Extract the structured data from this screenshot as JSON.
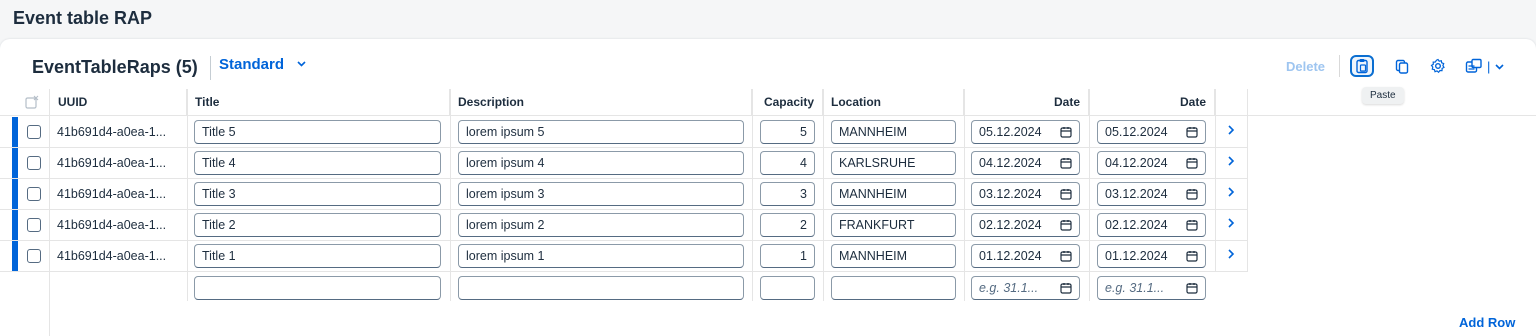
{
  "app": {
    "title": "Event table RAP"
  },
  "table": {
    "title": "EventTableRaps (5)",
    "variant": "Standard",
    "toolbar": {
      "delete": "Delete",
      "tooltip": "Paste"
    },
    "add_row": "Add Row",
    "columns": [
      "UUID",
      "Title",
      "Description",
      "Capacity",
      "Location",
      "Date",
      "Date"
    ],
    "rows": [
      {
        "uuid": "41b691d4-a0ea-1...",
        "title": "Title 5",
        "description": "lorem ipsum 5",
        "capacity": "5",
        "location": "MANNHEIM",
        "date1": "05.12.2024",
        "date2": "05.12.2024"
      },
      {
        "uuid": "41b691d4-a0ea-1...",
        "title": "Title 4",
        "description": "lorem ipsum 4",
        "capacity": "4",
        "location": "KARLSRUHE",
        "date1": "04.12.2024",
        "date2": "04.12.2024"
      },
      {
        "uuid": "41b691d4-a0ea-1...",
        "title": "Title 3",
        "description": "lorem ipsum 3",
        "capacity": "3",
        "location": "MANNHEIM",
        "date1": "03.12.2024",
        "date2": "03.12.2024"
      },
      {
        "uuid": "41b691d4-a0ea-1...",
        "title": "Title 2",
        "description": "lorem ipsum 2",
        "capacity": "2",
        "location": "FRANKFURT",
        "date1": "02.12.2024",
        "date2": "02.12.2024"
      },
      {
        "uuid": "41b691d4-a0ea-1...",
        "title": "Title 1",
        "description": "lorem ipsum 1",
        "capacity": "1",
        "location": "MANNHEIM",
        "date1": "01.12.2024",
        "date2": "01.12.2024"
      }
    ],
    "empty_row": {
      "date_placeholder": "e.g. 31.1..."
    }
  },
  "icons": [
    "select-all-icon",
    "paste-icon",
    "copy-icon",
    "settings-icon",
    "export-icon",
    "chevron-down-icon",
    "calendar-icon",
    "navigation-arrow-icon"
  ],
  "colors": {
    "accent": "#0064d9",
    "row_marker": "#0064d9",
    "background": "#f5f6f7"
  }
}
